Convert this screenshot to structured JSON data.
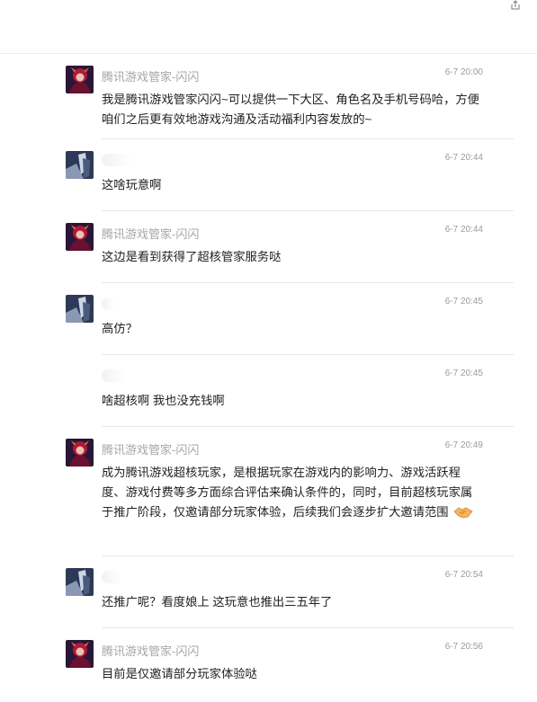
{
  "messages": [
    {
      "sender": "腾讯游戏管家-闪闪",
      "time": "6-7 20:00",
      "text": "我是腾讯游戏管家闪闪~可以提供一下大区、角色名及手机号码哈，方便咱们之后更有效地游戏沟通及活动福利内容发放的~"
    },
    {
      "sender": "",
      "time": "6-7 20:44",
      "text": "这啥玩意啊"
    },
    {
      "sender": "腾讯游戏管家-闪闪",
      "time": "6-7 20:44",
      "text": "这边是看到获得了超核管家服务哒"
    },
    {
      "sender": "",
      "time": "6-7 20:45",
      "text": "高仿？"
    },
    {
      "sender": "",
      "time": "6-7 20:45",
      "text": "啥超核啊 我也没充钱啊"
    },
    {
      "sender": "腾讯游戏管家-闪闪",
      "time": "6-7 20:49",
      "text": "成为腾讯游戏超核玩家，是根据玩家在游戏内的影响力、游戏活跃程度、游戏付费等多方面综合评估来确认条件的，同时，目前超核玩家属于推广阶段，仅邀请部分玩家体验，后续我们会逐步扩大邀请范围"
    },
    {
      "sender": "",
      "time": "6-7 20:54",
      "text": "还推广呢？看度娘上 这玩意也推出三五年了"
    },
    {
      "sender": "腾讯游戏管家-闪闪",
      "time": "6-7 20:56",
      "text": "目前是仅邀请部分玩家体验哒"
    }
  ],
  "icons": {
    "share": "share-icon",
    "handshake": "handshake-emoji-icon",
    "agent_avatar": "agent-avatar",
    "user_avatar": "user-avatar"
  }
}
